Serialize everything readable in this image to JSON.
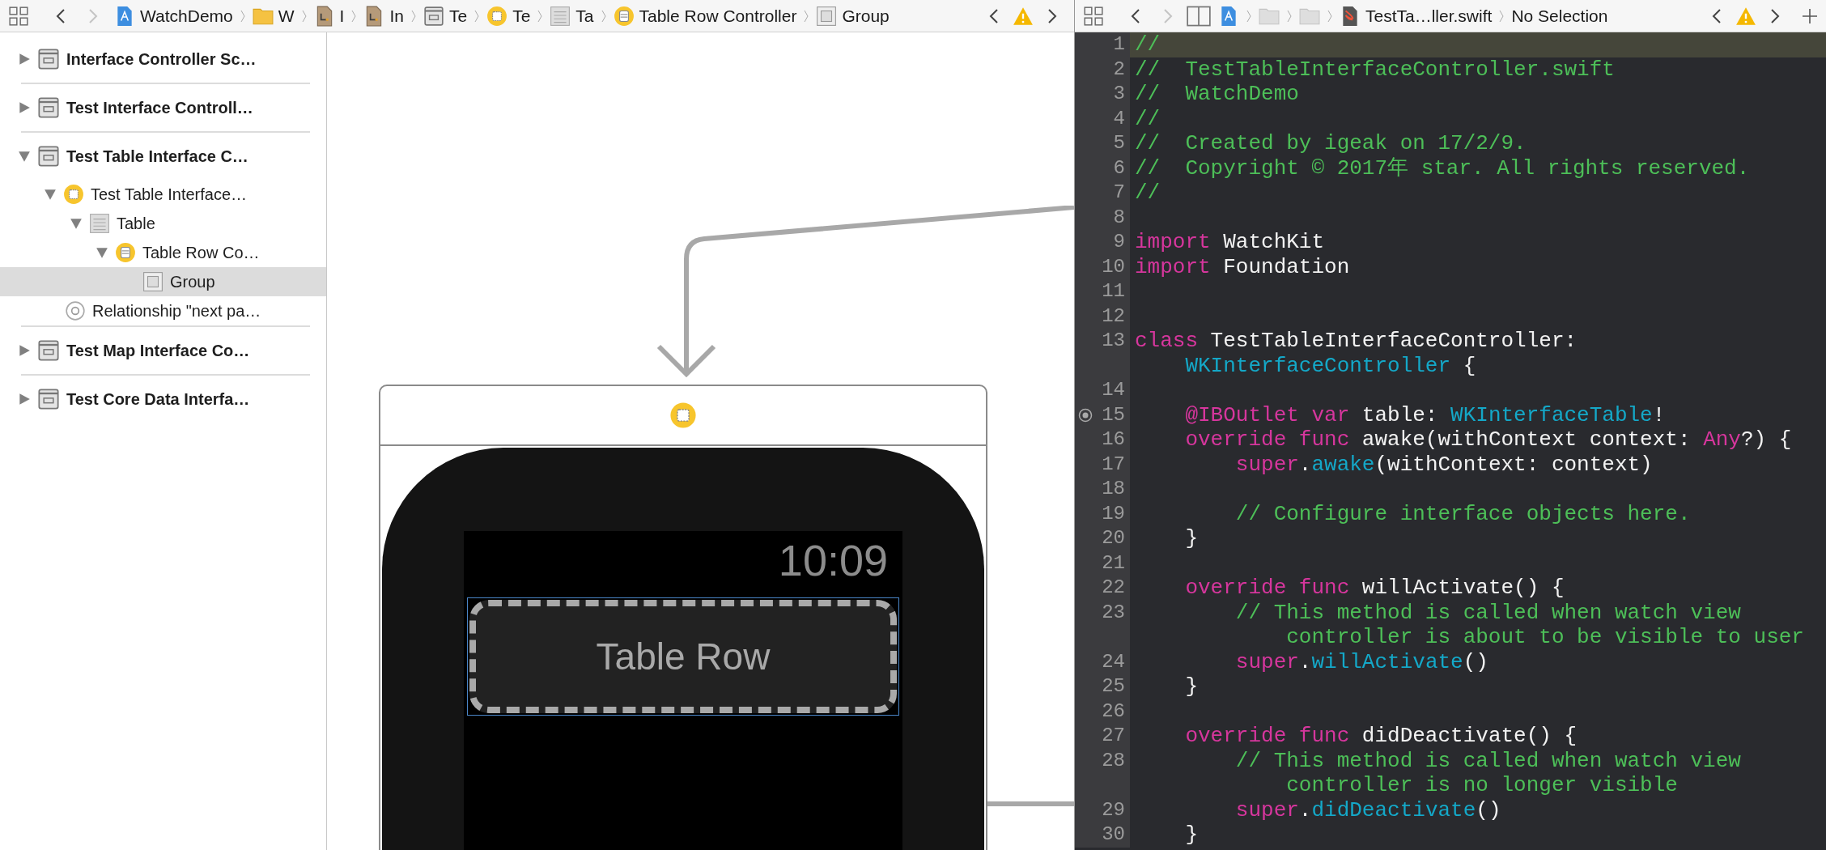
{
  "left_bar": {
    "nav": [
      {
        "kind": "back",
        "disabled": false
      },
      {
        "kind": "forward",
        "disabled": true
      }
    ],
    "crumbs": [
      {
        "kind": "project",
        "label": "WatchDemo"
      },
      {
        "kind": "folder",
        "label": "W"
      },
      {
        "kind": "storyboard",
        "label": "I"
      },
      {
        "kind": "storyboard",
        "label": "In"
      },
      {
        "kind": "scene",
        "label": "Te"
      },
      {
        "kind": "controller",
        "label": "Te"
      },
      {
        "kind": "table",
        "label": "Ta"
      },
      {
        "kind": "row",
        "label": "Table Row Controller"
      },
      {
        "kind": "group",
        "label": "Group"
      }
    ]
  },
  "right_bar": {
    "nav": [
      {
        "kind": "back",
        "disabled": false
      },
      {
        "kind": "forward",
        "disabled": true
      }
    ],
    "crumbs": [
      {
        "kind": "project"
      },
      {
        "kind": "folder-gray"
      },
      {
        "kind": "folder-gray"
      },
      {
        "kind": "swift",
        "label": "TestTa…ller.swift"
      },
      {
        "label": "No Selection"
      }
    ],
    "show_plus": true
  },
  "outline": [
    {
      "label": "Interface Controller Sc…",
      "kind": "scene",
      "expanded": false,
      "selected": false
    },
    {
      "label": "Test Interface Controll…",
      "kind": "scene",
      "expanded": false,
      "selected": false
    },
    {
      "label": "Test Table Interface C…",
      "kind": "scene",
      "expanded": true,
      "selected": false,
      "children": [
        {
          "label": "Test Table Interface…",
          "kind": "controller",
          "expanded": true,
          "selected": false,
          "children": [
            {
              "label": "Table",
              "kind": "table",
              "expanded": true,
              "selected": false,
              "children": [
                {
                  "label": "Table Row Co…",
                  "kind": "row",
                  "expanded": true,
                  "selected": false,
                  "children": [
                    {
                      "label": "Group",
                      "kind": "group",
                      "selected": true
                    }
                  ]
                }
              ]
            }
          ]
        },
        {
          "label": "Relationship \"next pa…",
          "kind": "relationship",
          "selected": false
        }
      ]
    },
    {
      "label": "Test Map Interface Co…",
      "kind": "scene",
      "expanded": false,
      "selected": false
    },
    {
      "label": "Test Core Data Interfa…",
      "kind": "scene",
      "expanded": false,
      "selected": false
    }
  ],
  "scene": {
    "time": "10:09",
    "row_label": "Table Row"
  },
  "code": [
    {
      "number": "1",
      "current": true,
      "outlet": false,
      "rows": [
        [
          {
            "kind": "comment",
            "text": "//"
          }
        ]
      ]
    },
    {
      "number": "2",
      "current": false,
      "outlet": false,
      "rows": [
        [
          {
            "kind": "comment",
            "text": "//  TestTableInterfaceController.swift"
          }
        ]
      ]
    },
    {
      "number": "3",
      "current": false,
      "outlet": false,
      "rows": [
        [
          {
            "kind": "comment",
            "text": "//  WatchDemo"
          }
        ]
      ]
    },
    {
      "number": "4",
      "current": false,
      "outlet": false,
      "rows": [
        [
          {
            "kind": "comment",
            "text": "//"
          }
        ]
      ]
    },
    {
      "number": "5",
      "current": false,
      "outlet": false,
      "rows": [
        [
          {
            "kind": "comment",
            "text": "//  Created by igeak on 17/2/9."
          }
        ]
      ]
    },
    {
      "number": "6",
      "current": false,
      "outlet": false,
      "rows": [
        [
          {
            "kind": "comment",
            "text": "//  Copyright © 2017年 star. All rights reserved."
          }
        ]
      ]
    },
    {
      "number": "7",
      "current": false,
      "outlet": false,
      "rows": [
        [
          {
            "kind": "comment",
            "text": "//"
          }
        ]
      ]
    },
    {
      "number": "8",
      "current": false,
      "outlet": false
    },
    {
      "number": "9",
      "current": false,
      "outlet": false,
      "rows": [
        [
          {
            "kind": "keyword",
            "text": "import"
          },
          {
            "kind": "plain",
            "text": " WatchKit"
          }
        ]
      ]
    },
    {
      "number": "10",
      "current": false,
      "outlet": false,
      "rows": [
        [
          {
            "kind": "keyword",
            "text": "import"
          },
          {
            "kind": "plain",
            "text": " Foundation"
          }
        ]
      ]
    },
    {
      "number": "11",
      "current": false,
      "outlet": false
    },
    {
      "number": "12",
      "current": false,
      "outlet": false
    },
    {
      "number": "13",
      "current": false,
      "outlet": false,
      "rows": [
        [
          {
            "kind": "keyword",
            "text": "class"
          },
          {
            "kind": "plain",
            "text": " TestTableInterfaceController:"
          }
        ],
        [
          {
            "kind": "type",
            "text": "    WKInterfaceController"
          },
          {
            "kind": "plain",
            "text": " {"
          }
        ]
      ]
    },
    {
      "number": "14",
      "current": false,
      "outlet": false
    },
    {
      "number": "15",
      "current": false,
      "outlet": true,
      "rows": [
        [
          {
            "kind": "keyword",
            "text": "    @IBOutlet var"
          },
          {
            "kind": "plain",
            "text": " table: "
          },
          {
            "kind": "type",
            "text": "WKInterfaceTable"
          },
          {
            "kind": "plain",
            "text": "!"
          }
        ]
      ]
    },
    {
      "number": "16",
      "current": false,
      "outlet": false,
      "rows": [
        [
          {
            "kind": "keyword",
            "text": "    override func"
          },
          {
            "kind": "plain",
            "text": " awake(withContext context: "
          },
          {
            "kind": "keyword",
            "text": "Any"
          },
          {
            "kind": "plain",
            "text": "?) {"
          }
        ]
      ]
    },
    {
      "number": "17",
      "current": false,
      "outlet": false,
      "rows": [
        [
          {
            "kind": "keyword",
            "text": "        super"
          },
          {
            "kind": "plain",
            "text": "."
          },
          {
            "kind": "type",
            "text": "awake"
          },
          {
            "kind": "plain",
            "text": "(withContext: context)"
          }
        ]
      ]
    },
    {
      "number": "18",
      "current": false,
      "outlet": false
    },
    {
      "number": "19",
      "current": false,
      "outlet": false,
      "rows": [
        [
          {
            "kind": "comment",
            "text": "        // Configure interface objects here."
          }
        ]
      ]
    },
    {
      "number": "20",
      "current": false,
      "outlet": false,
      "rows": [
        [
          {
            "kind": "plain",
            "text": "    }"
          }
        ]
      ]
    },
    {
      "number": "21",
      "current": false,
      "outlet": false
    },
    {
      "number": "22",
      "current": false,
      "outlet": false,
      "rows": [
        [
          {
            "kind": "keyword",
            "text": "    override func"
          },
          {
            "kind": "plain",
            "text": " willActivate() {"
          }
        ]
      ]
    },
    {
      "number": "23",
      "current": false,
      "outlet": false,
      "rows": [
        [
          {
            "kind": "comment",
            "text": "        // This method is called when watch view"
          }
        ],
        [
          {
            "kind": "comment",
            "text": "            controller is about to be visible to user"
          }
        ]
      ]
    },
    {
      "number": "24",
      "current": false,
      "outlet": false,
      "rows": [
        [
          {
            "kind": "keyword",
            "text": "        super"
          },
          {
            "kind": "plain",
            "text": "."
          },
          {
            "kind": "type",
            "text": "willActivate"
          },
          {
            "kind": "plain",
            "text": "()"
          }
        ]
      ]
    },
    {
      "number": "25",
      "current": false,
      "outlet": false,
      "rows": [
        [
          {
            "kind": "plain",
            "text": "    }"
          }
        ]
      ]
    },
    {
      "number": "26",
      "current": false,
      "outlet": false
    },
    {
      "number": "27",
      "current": false,
      "outlet": false,
      "rows": [
        [
          {
            "kind": "keyword",
            "text": "    override func"
          },
          {
            "kind": "plain",
            "text": " didDeactivate() {"
          }
        ]
      ]
    },
    {
      "number": "28",
      "current": false,
      "outlet": false,
      "rows": [
        [
          {
            "kind": "comment",
            "text": "        // This method is called when watch view"
          }
        ],
        [
          {
            "kind": "comment",
            "text": "            controller is no longer visible"
          }
        ]
      ]
    },
    {
      "number": "29",
      "current": false,
      "outlet": false,
      "rows": [
        [
          {
            "kind": "keyword",
            "text": "        super"
          },
          {
            "kind": "plain",
            "text": "."
          },
          {
            "kind": "type",
            "text": "didDeactivate"
          },
          {
            "kind": "plain",
            "text": "()"
          }
        ]
      ]
    },
    {
      "number": "30",
      "current": false,
      "outlet": false,
      "rows": [
        [
          {
            "kind": "plain",
            "text": "    }"
          }
        ]
      ]
    }
  ]
}
